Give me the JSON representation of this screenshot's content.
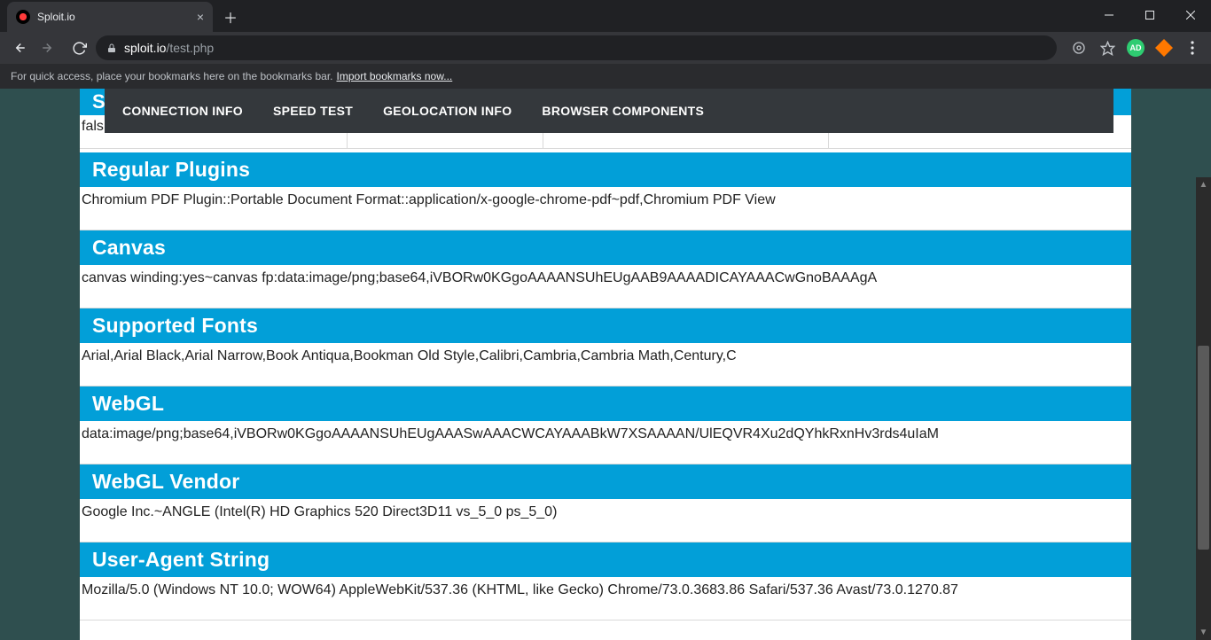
{
  "browser": {
    "tab_title": "Sploit.io",
    "url_host": "sploit.io",
    "url_path": "/test.php",
    "bookmarks_hint": "For quick access, place your bookmarks here on the bookmarks bar.",
    "bookmarks_link": "Import bookmarks now...",
    "ad_badge": "AD"
  },
  "nav": {
    "items": [
      "CONNECTION INFO",
      "SPEED TEST",
      "GEOLOCATION INFO",
      "BROWSER COMPONENTS"
    ]
  },
  "peek_header": "S",
  "remnant_cell": "fals",
  "sections": [
    {
      "title": "Regular Plugins",
      "value": "Chromium PDF Plugin::Portable Document Format::application/x-google-chrome-pdf~pdf,Chromium PDF View"
    },
    {
      "title": "Canvas",
      "value": "canvas winding:yes~canvas fp:data:image/png;base64,iVBORw0KGgoAAAANSUhEUgAAB9AAAADICAYAAACwGnoBAAAgA"
    },
    {
      "title": "Supported Fonts",
      "value": "Arial,Arial Black,Arial Narrow,Book Antiqua,Bookman Old Style,Calibri,Cambria,Cambria Math,Century,C"
    },
    {
      "title": "WebGL",
      "value": "data:image/png;base64,iVBORw0KGgoAAAANSUhEUgAAASwAAACWCAYAAABkW7XSAAAAN/UlEQVR4Xu2dQYhkRxnHv3rds4uIaM"
    },
    {
      "title": "WebGL Vendor",
      "value": "Google Inc.~ANGLE (Intel(R) HD Graphics 520 Direct3D11 vs_5_0 ps_5_0)"
    },
    {
      "title": "User-Agent String",
      "value": "Mozilla/5.0 (Windows NT 10.0; WOW64) AppleWebKit/537.36 (KHTML, like Gecko) Chrome/73.0.3683.86 Safari/537.36 Avast/73.0.1270.87"
    }
  ]
}
